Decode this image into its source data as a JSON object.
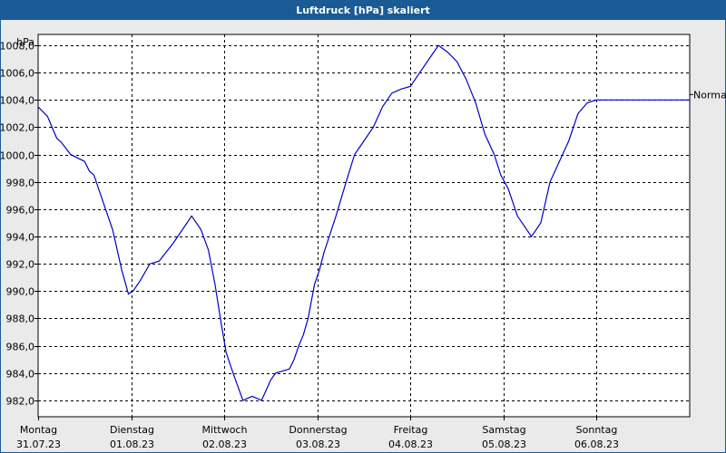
{
  "window": {
    "title": "Luftdruck [hPa] skaliert"
  },
  "chart_data": {
    "type": "line",
    "title": "Luftdruck [hPa] skaliert",
    "ylabel": "hPa",
    "xlabel": "",
    "ylim": [
      980.8,
      1008.8
    ],
    "yticks": [
      982.0,
      984.0,
      986.0,
      988.0,
      990.0,
      992.0,
      994.0,
      996.0,
      998.0,
      1000.0,
      1002.0,
      1004.0,
      1006.0,
      1008.0
    ],
    "ytick_labels": [
      "982,0",
      "984,0",
      "986,0",
      "988,0",
      "990,0",
      "992,0",
      "994,0",
      "996,0",
      "998,0",
      "1000,0",
      "1002,0",
      "1004,0",
      "1006,0",
      "1008,0"
    ],
    "xlim": [
      0,
      7
    ],
    "xticks": [
      {
        "x": 0,
        "day": "Montag",
        "date": "31.07.23"
      },
      {
        "x": 1,
        "day": "Dienstag",
        "date": "01.08.23"
      },
      {
        "x": 2,
        "day": "Mittwoch",
        "date": "02.08.23"
      },
      {
        "x": 3,
        "day": "Donnerstag",
        "date": "03.08.23"
      },
      {
        "x": 4,
        "day": "Freitag",
        "date": "04.08.23"
      },
      {
        "x": 5,
        "day": "Samstag",
        "date": "05.08.23"
      },
      {
        "x": 6,
        "day": "Sonntag",
        "date": "06.08.23"
      }
    ],
    "reference_line": {
      "label": "Normal",
      "value": 1004.0
    },
    "grid": true,
    "series": [
      {
        "color": "#0000cc",
        "x": [
          0.0,
          0.1,
          0.2,
          0.25,
          0.35,
          0.5,
          0.55,
          0.6,
          0.7,
          0.8,
          0.9,
          0.97,
          1.02,
          1.1,
          1.2,
          1.3,
          1.37,
          1.45,
          1.55,
          1.65,
          1.75,
          1.83,
          1.9,
          1.97,
          2.02,
          2.08,
          2.12,
          2.2,
          2.3,
          2.4,
          2.5,
          2.55,
          2.6,
          2.65,
          2.7,
          2.75,
          2.8,
          2.85,
          2.9,
          2.97,
          3.02,
          3.07,
          3.2,
          3.3,
          3.4,
          3.5,
          3.6,
          3.7,
          3.8,
          3.9,
          4.0,
          4.1,
          4.2,
          4.3,
          4.4,
          4.5,
          4.6,
          4.7,
          4.8,
          4.9,
          4.97,
          5.05,
          5.15,
          5.3,
          5.4,
          5.5,
          5.6,
          5.7,
          5.8,
          5.9,
          6.0,
          6.1,
          6.2,
          6.25,
          6.3,
          6.4,
          6.5,
          6.6,
          6.7,
          6.8,
          6.85,
          6.9,
          6.95,
          7.0
        ],
        "y": [
          1003.5,
          1002.8,
          1001.2,
          1000.9,
          1000.0,
          999.5,
          998.8,
          998.5,
          996.5,
          994.5,
          991.5,
          989.8,
          990.0,
          990.8,
          992.0,
          992.2,
          992.8,
          993.5,
          994.5,
          995.5,
          994.5,
          993.0,
          990.5,
          987.5,
          985.5,
          984.3,
          983.5,
          982.0,
          982.3,
          982.0,
          983.5,
          984.0,
          984.1,
          984.2,
          984.3,
          985.0,
          986.0,
          986.8,
          988.0,
          990.5,
          991.5,
          992.8,
          995.5,
          997.8,
          1000.0,
          1001.0,
          1002.0,
          1003.5,
          1004.5,
          1004.8,
          1005.0,
          1006.0,
          1007.0,
          1008.0,
          1007.5,
          1006.8,
          1005.5,
          1003.8,
          1001.5,
          1000.0,
          998.5,
          997.5,
          995.5,
          994.0,
          995.0,
          998.0,
          999.5,
          1001.0,
          1003.0,
          1003.8,
          1004.0,
          1004.0,
          1004.0,
          1004.0,
          1004.0,
          1004.0,
          1004.0,
          1004.0,
          1004.0,
          1004.0,
          1004.0,
          1004.0,
          1004.0,
          1004.0
        ]
      }
    ]
  }
}
